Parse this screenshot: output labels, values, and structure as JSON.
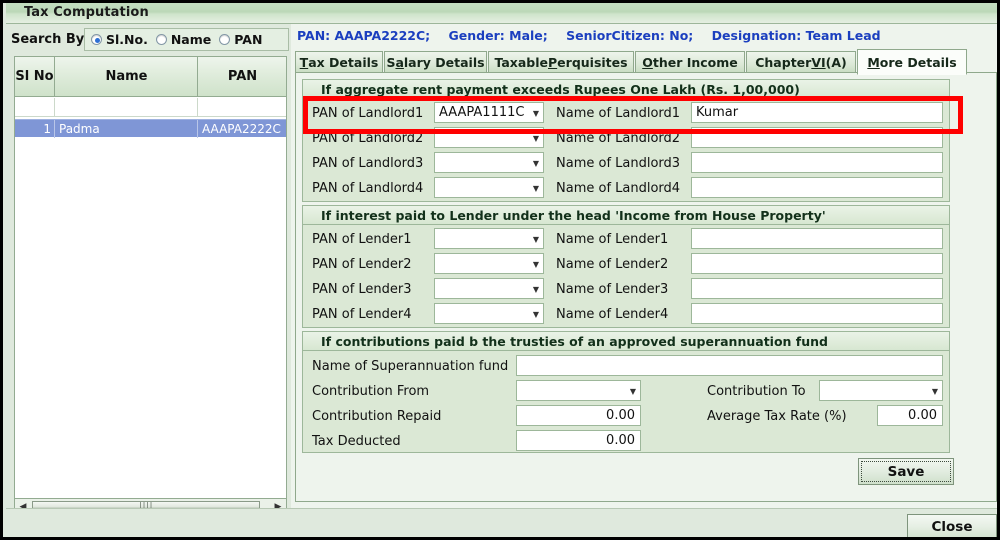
{
  "window": {
    "title": "Tax Computation"
  },
  "search": {
    "label": "Search By",
    "options": [
      {
        "label": "Sl.No.",
        "selected": true
      },
      {
        "label": "Name",
        "selected": false
      },
      {
        "label": "PAN",
        "selected": false
      }
    ]
  },
  "grid": {
    "columns": [
      "Sl No",
      "Name",
      "PAN"
    ],
    "rows": [
      {
        "sl": "1",
        "name": "Padma",
        "pan": "AAAPA2222C",
        "selected": true
      }
    ]
  },
  "scrollbar": {
    "left_arrow": "◀",
    "right_arrow": "▶",
    "grip": "||||"
  },
  "info": {
    "pan": "PAN: AAAPA2222C;",
    "gender": "Gender: Male;",
    "senior_citizen": "SeniorCitizen: No;",
    "designation": "Designation: Team Lead",
    "color": "#1b3fbf"
  },
  "tabs": [
    {
      "pre": "",
      "mnemonic": "T",
      "post": "ax Details",
      "active": false
    },
    {
      "pre": "S",
      "mnemonic": "a",
      "post": "lary Details",
      "active": false
    },
    {
      "pre": "Taxable ",
      "mnemonic": "P",
      "post": "erquisites",
      "active": false
    },
    {
      "pre": "",
      "mnemonic": "O",
      "post": "ther Income",
      "active": false
    },
    {
      "pre": "Chapter ",
      "mnemonic": "VI",
      "post": "(A)",
      "active": false
    },
    {
      "pre": "",
      "mnemonic": "M",
      "post": "ore Details",
      "active": true
    }
  ],
  "landlord_group": {
    "title": "If aggregate rent payment exceeds Rupees One Lakh (Rs. 1,00,000)",
    "rows": [
      {
        "pan_label": "PAN of Landlord1",
        "pan_value": "AAAPA1111C",
        "name_label": "Name of Landlord1",
        "name_value": "Kumar"
      },
      {
        "pan_label": "PAN of Landlord2",
        "pan_value": "",
        "name_label": "Name of Landlord2",
        "name_value": ""
      },
      {
        "pan_label": "PAN of Landlord3",
        "pan_value": "",
        "name_label": "Name of Landlord3",
        "name_value": ""
      },
      {
        "pan_label": "PAN of Landlord4",
        "pan_value": "",
        "name_label": "Name of Landlord4",
        "name_value": ""
      }
    ]
  },
  "lender_group": {
    "title": "If interest paid to Lender under the head 'Income from House Property'",
    "rows": [
      {
        "pan_label": "PAN of Lender1",
        "pan_value": "",
        "name_label": "Name of Lender1",
        "name_value": ""
      },
      {
        "pan_label": "PAN of Lender2",
        "pan_value": "",
        "name_label": "Name of Lender2",
        "name_value": ""
      },
      {
        "pan_label": "PAN of Lender3",
        "pan_value": "",
        "name_label": "Name of Lender3",
        "name_value": ""
      },
      {
        "pan_label": "PAN of Lender4",
        "pan_value": "",
        "name_label": "Name of Lender4",
        "name_value": ""
      }
    ]
  },
  "super_group": {
    "title": "If contributions paid b the trusties of an approved superannuation fund",
    "fund_name_label": "Name of Superannuation fund",
    "fund_name_value": "",
    "contribution_from_label": "Contribution From",
    "contribution_from_value": "",
    "contribution_to_label": "Contribution To",
    "contribution_to_value": "",
    "contribution_repaid_label": "Contribution Repaid",
    "contribution_repaid_value": "0.00",
    "average_tax_rate_label": "Average Tax Rate (%)",
    "average_tax_rate_value": "0.00",
    "tax_deducted_label": "Tax Deducted",
    "tax_deducted_value": "0.00"
  },
  "buttons": {
    "save": "Save",
    "close": "Close"
  },
  "annotation": {
    "color": "#ff0000",
    "target": "landlord-row-1"
  },
  "icons": {
    "dropdown_caret": "▼"
  }
}
